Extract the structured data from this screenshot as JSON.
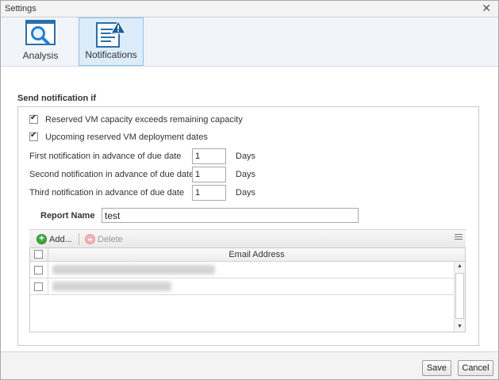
{
  "window": {
    "title": "Settings",
    "close_glyph": "✕"
  },
  "tabs": [
    {
      "label": "Analysis",
      "icon": "magnifier-icon",
      "active": false
    },
    {
      "label": "Notifications",
      "icon": "report-warning-icon",
      "active": true
    }
  ],
  "section": {
    "title": "Send notification if"
  },
  "options": [
    {
      "label": "Reserved VM capacity exceeds remaining capacity",
      "checked": true
    },
    {
      "label": "Upcoming reserved VM deployment dates",
      "checked": true
    }
  ],
  "advance": [
    {
      "label": "First notification in advance of due date",
      "value": "1",
      "unit": "Days"
    },
    {
      "label": "Second notification in advance of due date",
      "value": "1",
      "unit": "Days"
    },
    {
      "label": "Third notification in advance of due date",
      "value": "1",
      "unit": "Days"
    }
  ],
  "report": {
    "label": "Report Name",
    "value": "test"
  },
  "grid": {
    "toolbar": {
      "add_label": "Add...",
      "delete_label": "Delete"
    },
    "column_header": "Email Address"
  },
  "footer": {
    "save_label": "Save",
    "cancel_label": "Cancel"
  },
  "colors": {
    "accent": "#1f7fd6",
    "active_tab_bg": "#dcecfb",
    "add_green": "#3ea63a"
  }
}
